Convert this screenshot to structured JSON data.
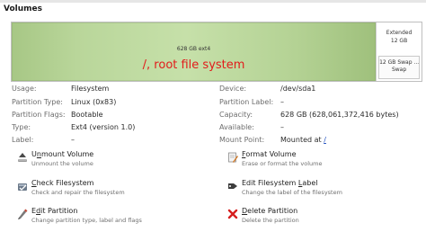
{
  "section": {
    "title": "Volumes"
  },
  "volumes": {
    "root": {
      "size_label": "628 GB ext4",
      "title": "/, root file system"
    },
    "extended": {
      "label_line1": "Extended",
      "label_line2": "12 GB"
    },
    "swap": {
      "label_line1": "12 GB Swap ...",
      "label_line2": "Swap"
    }
  },
  "properties": {
    "left": [
      {
        "label": "Usage:",
        "value": "Filesystem"
      },
      {
        "label": "Partition Type:",
        "value": "Linux (0x83)"
      },
      {
        "label": "Partition Flags:",
        "value": "Bootable"
      },
      {
        "label": "Type:",
        "value": "Ext4 (version 1.0)"
      },
      {
        "label": "Label:",
        "value": "–"
      }
    ],
    "right": [
      {
        "label": "Device:",
        "value": "/dev/sda1"
      },
      {
        "label": "Partition Label:",
        "value": "–"
      },
      {
        "label": "Capacity:",
        "value": "628 GB (628,061,372,416 bytes)"
      },
      {
        "label": "Available:",
        "value": "–"
      },
      {
        "label": "Mount Point:",
        "value": "Mounted at",
        "link": "/"
      }
    ]
  },
  "actions": [
    {
      "title": "Unmount Volume",
      "mnemonic": "n",
      "desc": "Unmount the volume",
      "icon": "unmount-icon"
    },
    {
      "title": "Format Volume",
      "mnemonic": "F",
      "desc": "Erase or format the volume",
      "icon": "format-icon"
    },
    {
      "title": "Check Filesystem",
      "mnemonic": "C",
      "desc": "Check and repair the filesystem",
      "icon": "check-filesystem-icon"
    },
    {
      "title": "Edit Filesystem Label",
      "mnemonic": "L",
      "desc": "Change the label of the filesystem",
      "icon": "edit-label-icon"
    },
    {
      "title": "Edit Partition",
      "mnemonic": "d",
      "desc": "Change partition type, label and flags",
      "icon": "edit-partition-icon"
    },
    {
      "title": "Delete Partition",
      "mnemonic": "D",
      "desc": "Delete the partition",
      "icon": "delete-partition-icon"
    }
  ]
}
